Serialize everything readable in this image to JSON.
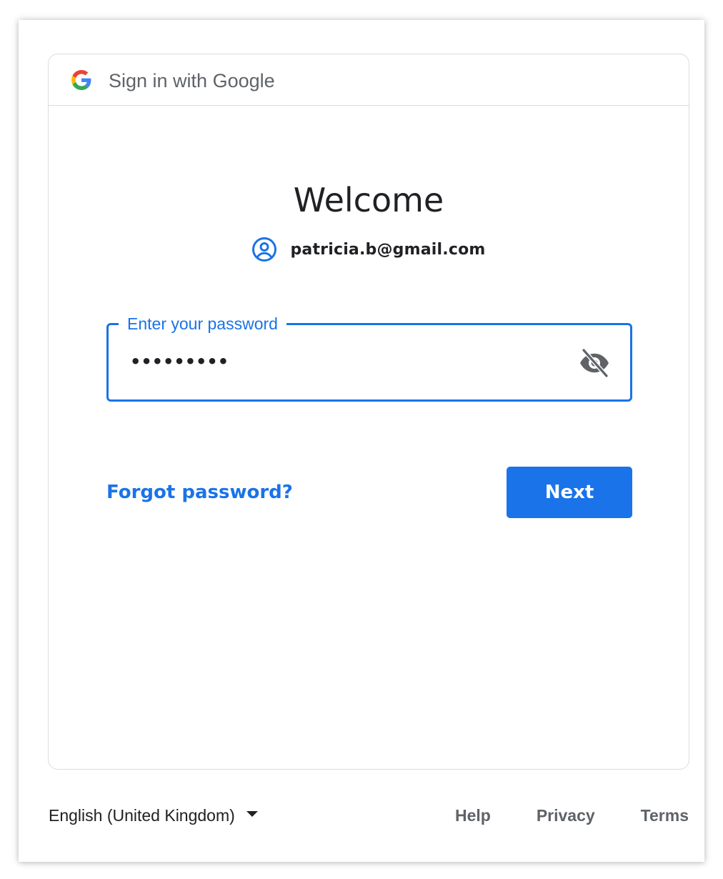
{
  "header": {
    "title": "Sign in with Google",
    "logo_icon": "google-g-icon"
  },
  "main": {
    "heading": "Welcome",
    "account": {
      "icon": "account-circle-icon",
      "email": "patricia.b@gmail.com"
    },
    "password": {
      "label": "Enter your password",
      "value": "•••••••••",
      "toggle_icon": "eye-off-icon"
    },
    "forgot_label": "Forgot password?",
    "next_label": "Next"
  },
  "footer": {
    "language": "English (United Kingdom)",
    "links": [
      "Help",
      "Privacy",
      "Terms"
    ]
  },
  "colors": {
    "accent": "#1a73e8",
    "text": "#202124",
    "muted": "#5f6368",
    "border": "#dadce0"
  }
}
